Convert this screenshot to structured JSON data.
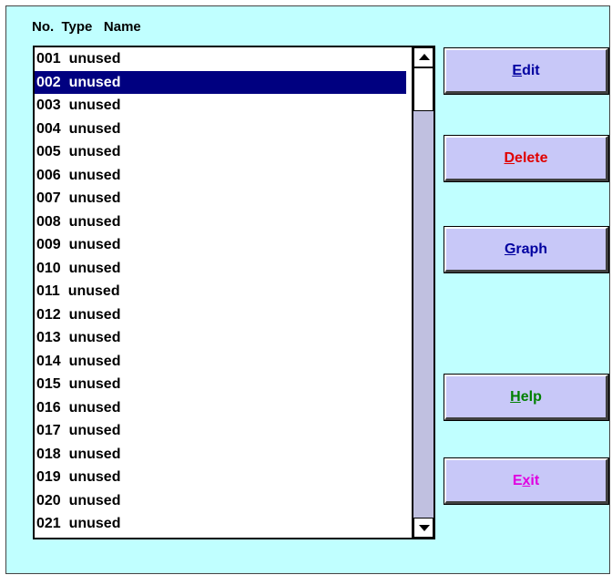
{
  "header": {
    "text": "No.  Type   Name"
  },
  "list": {
    "selected_index": 1,
    "items": [
      "001  unused",
      "002  unused",
      "003  unused",
      "004  unused",
      "005  unused",
      "006  unused",
      "007  unused",
      "008  unused",
      "009  unused",
      "010  unused",
      "011  unused",
      "012  unused",
      "013  unused",
      "014  unused",
      "015  unused",
      "016  unused",
      "017  unused",
      "018  unused",
      "019  unused",
      "020  unused",
      "021  unused"
    ]
  },
  "buttons": {
    "edit": {
      "mnemonic": "E",
      "rest": "dit",
      "color": "#0000a0"
    },
    "delete": {
      "mnemonic": "D",
      "rest": "elete",
      "color": "#e00000"
    },
    "graph": {
      "mnemonic": "G",
      "rest": "raph",
      "color": "#0000a0"
    },
    "help": {
      "mnemonic": "H",
      "rest": "elp",
      "color": "#008000"
    },
    "exit": {
      "pre": "E",
      "mnemonic": "x",
      "rest": "it",
      "color": "#e000e0"
    }
  },
  "colors": {
    "window_bg": "#c0ffff",
    "selection_bg": "#000080",
    "button_face": "#c8c8f8"
  }
}
